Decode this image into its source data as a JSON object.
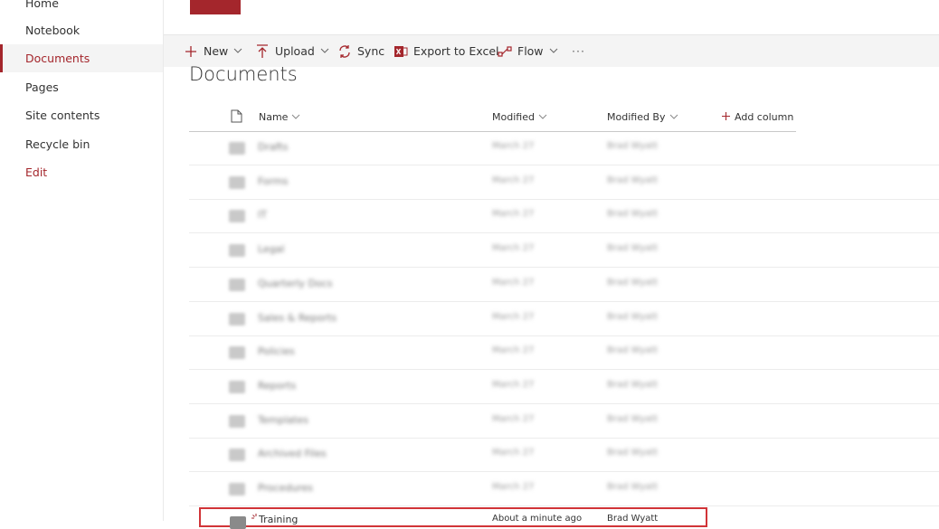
{
  "sidebar": {
    "items": [
      {
        "label": "Home"
      },
      {
        "label": "Notebook"
      },
      {
        "label": "Documents"
      },
      {
        "label": "Pages"
      },
      {
        "label": "Site contents"
      },
      {
        "label": "Recycle bin"
      },
      {
        "label": "Edit"
      }
    ]
  },
  "commandbar": {
    "new": "New",
    "upload": "Upload",
    "sync": "Sync",
    "export": "Export to Excel",
    "flow": "Flow",
    "more": "···"
  },
  "page_title": "Documents",
  "columns": {
    "name": "Name",
    "modified": "Modified",
    "modified_by": "Modified By",
    "add_column": "Add column"
  },
  "rows": [
    {
      "name": "Drafts",
      "modified": "March 27",
      "by": "Brad Wyatt"
    },
    {
      "name": "Forms",
      "modified": "March 27",
      "by": "Brad Wyatt"
    },
    {
      "name": "IT",
      "modified": "March 27",
      "by": "Brad Wyatt"
    },
    {
      "name": "Legal",
      "modified": "March 27",
      "by": "Brad Wyatt"
    },
    {
      "name": "Quarterly Docs",
      "modified": "March 27",
      "by": "Brad Wyatt"
    },
    {
      "name": "Sales & Reports",
      "modified": "March 27",
      "by": "Brad Wyatt"
    },
    {
      "name": "Policies",
      "modified": "March 27",
      "by": "Brad Wyatt"
    },
    {
      "name": "Reports",
      "modified": "March 27",
      "by": "Brad Wyatt"
    },
    {
      "name": "Templates",
      "modified": "March 27",
      "by": "Brad Wyatt"
    },
    {
      "name": "Archived Files",
      "modified": "March 27",
      "by": "Brad Wyatt"
    },
    {
      "name": "Procedures",
      "modified": "March 27",
      "by": "Brad Wyatt"
    }
  ],
  "new_row": {
    "name": "Training",
    "modified": "About a minute ago",
    "by": "Brad Wyatt"
  },
  "colors": {
    "accent": "#a4262c",
    "highlight": "#d13438"
  }
}
